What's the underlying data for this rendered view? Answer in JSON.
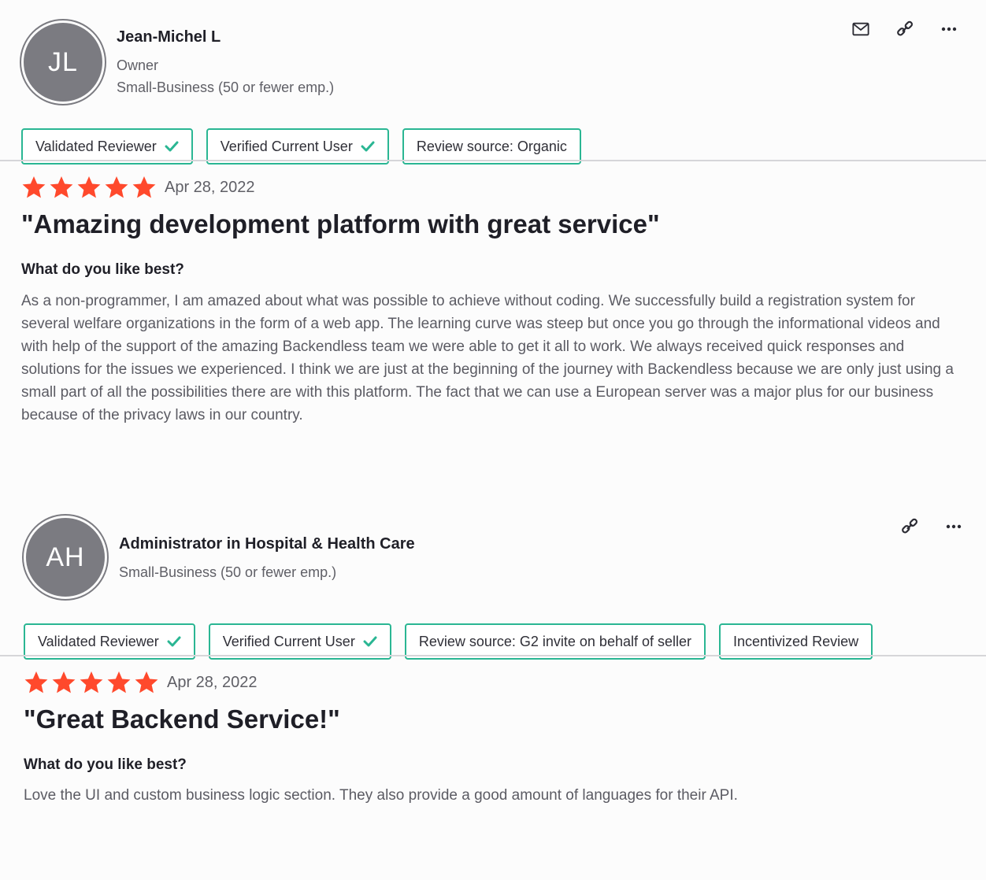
{
  "reviews": [
    {
      "reviewer": {
        "initials": "JL",
        "name": "Jean-Michel L",
        "lines": [
          "Owner",
          "Small-Business (50 or fewer emp.)"
        ]
      },
      "actions": [
        "mail-icon",
        "link-icon",
        "more-icon"
      ],
      "badges": [
        {
          "label": "Validated Reviewer",
          "check": true
        },
        {
          "label": "Verified Current User",
          "check": true
        },
        {
          "label": "Review source: Organic",
          "check": false
        }
      ],
      "rating": 5,
      "date": "Apr 28, 2022",
      "title": "\"Amazing development platform with great service\"",
      "question": "What do you like best?",
      "answer": "As a non-programmer, I am amazed about what was possible to achieve without coding. We successfully build a registration system for several welfare organizations in the form of a web app. The learning curve was steep but once you go through the informational videos and with help of the support of the amazing Backendless team we were able to get it all to work. We always received quick responses and solutions for the issues we experienced. I think we are just at the beginning of the journey with Backendless because we are only just using a small part of all the possibilities there are with this platform. The fact that we can use a European server was a major plus for our business because of the privacy laws in our country."
    },
    {
      "reviewer": {
        "initials": "AH",
        "name": "Administrator in Hospital & Health Care",
        "lines": [
          "Small-Business (50 or fewer emp.)"
        ]
      },
      "actions": [
        "link-icon",
        "more-icon"
      ],
      "badges": [
        {
          "label": "Validated Reviewer",
          "check": true
        },
        {
          "label": "Verified Current User",
          "check": true
        },
        {
          "label": "Review source: G2 invite on behalf of seller",
          "check": false
        },
        {
          "label": "Incentivized Review",
          "check": false
        }
      ],
      "rating": 5,
      "date": "Apr 28, 2022",
      "title": "\"Great Backend Service!\"",
      "question": "What do you like best?",
      "answer": "Love the UI and custom business logic section. They also provide a good amount of languages for their API."
    }
  ],
  "colors": {
    "star": "#ff492c",
    "badge_border": "#2ab693",
    "check": "#2ab693",
    "avatar_bg": "#7b7b81"
  }
}
